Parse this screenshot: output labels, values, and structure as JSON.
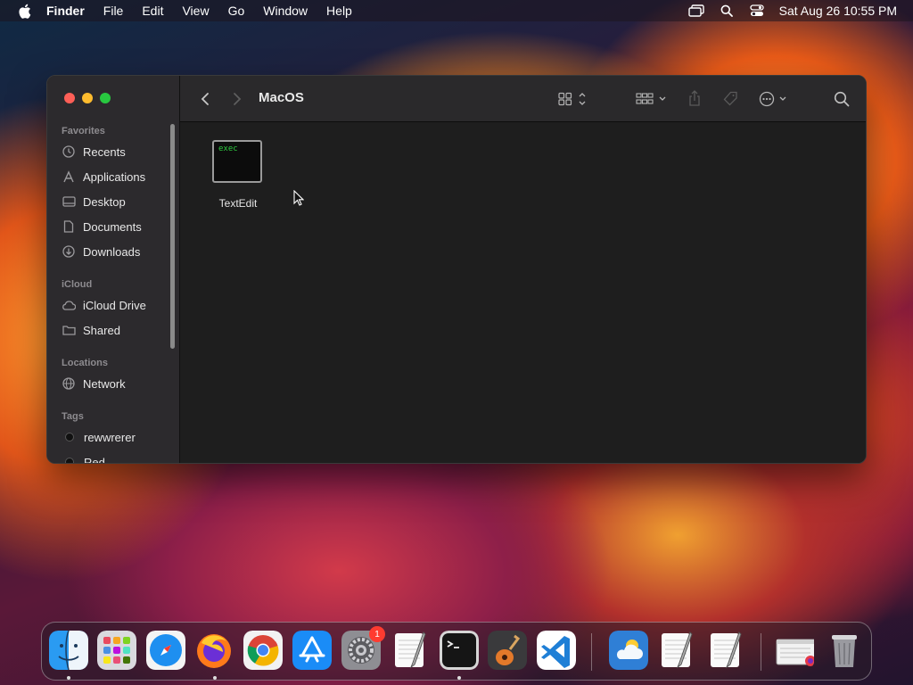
{
  "menubar": {
    "app_name": "Finder",
    "items": [
      "File",
      "Edit",
      "View",
      "Go",
      "Window",
      "Help"
    ],
    "clock": "Sat Aug 26  10:55 PM"
  },
  "window": {
    "title": "MacOS",
    "sidebar": {
      "favorites_header": "Favorites",
      "favorites": [
        "Recents",
        "Applications",
        "Desktop",
        "Documents",
        "Downloads"
      ],
      "icloud_header": "iCloud",
      "icloud": [
        "iCloud Drive",
        "Shared"
      ],
      "locations_header": "Locations",
      "locations": [
        "Network"
      ],
      "tags_header": "Tags",
      "tags": [
        "rewwrerer",
        "Red"
      ]
    },
    "files": [
      {
        "name": "TextEdit",
        "thumb_text": "exec"
      }
    ]
  },
  "dock": {
    "apps": [
      "Finder",
      "Launchpad",
      "Safari",
      "Firefox",
      "Chrome",
      "App Store",
      "System Settings",
      "TextEdit",
      "Terminal",
      "GarageBand",
      "VS Code",
      "Weather",
      "TextEdit",
      "TextEdit",
      "Preview",
      "Trash"
    ],
    "settings_badge": "1"
  },
  "colors": {
    "close": "#fe5f57",
    "minimize": "#febc2e",
    "maximize": "#28c840",
    "badge": "#ff3b30"
  }
}
